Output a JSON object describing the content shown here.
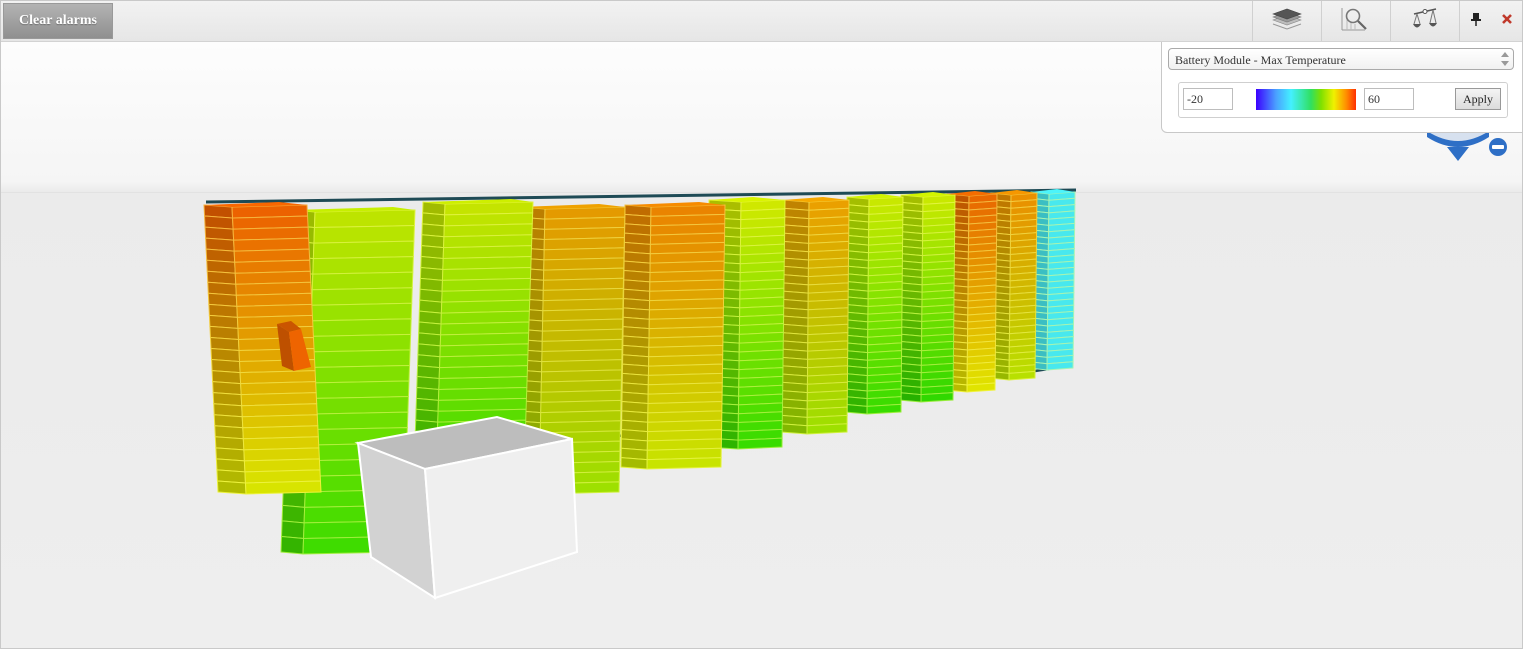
{
  "toolbar": {
    "clear_alarms_label": "Clear alarms",
    "tools": [
      {
        "name": "layers",
        "icon": "layers-icon"
      },
      {
        "name": "chart-search",
        "icon": "chart-search-icon"
      },
      {
        "name": "balance",
        "icon": "balance-scale-icon"
      }
    ],
    "pin_icon": "pin-icon",
    "close_icon": "close-icon"
  },
  "panel": {
    "metric_selected": "Battery Module - Max Temperature",
    "range_min": "-20",
    "range_max": "60",
    "apply_label": "Apply",
    "gradient_stops": [
      "#3b00ff",
      "#4aa0ff",
      "#44f0ff",
      "#30e060",
      "#7ee000",
      "#f0f000",
      "#ff9000",
      "#ff3000"
    ]
  },
  "navigation": {
    "pan_icon": "navigation-compass-icon",
    "zoom_out_icon": "zoom-out-icon",
    "zoom_in_icon": "zoom-in-icon"
  },
  "scene": {
    "racks": [
      {
        "id": "rack-1",
        "top_color": "#ec6200",
        "bottom_color": "#d8e400"
      },
      {
        "id": "rack-2",
        "top_color": "#bde400",
        "bottom_color": "#3fdc00"
      },
      {
        "id": "rack-3",
        "top_color": "#c4e400",
        "bottom_color": "#4fdc00"
      },
      {
        "id": "rack-4",
        "top_color": "#e49a00",
        "bottom_color": "#9ee000"
      },
      {
        "id": "rack-5",
        "top_color": "#ea8400",
        "bottom_color": "#c8e400"
      },
      {
        "id": "rack-6",
        "top_color": "#cfe800",
        "bottom_color": "#38dc00"
      },
      {
        "id": "rack-7",
        "top_color": "#eaa000",
        "bottom_color": "#9ee000"
      },
      {
        "id": "rack-8",
        "top_color": "#c8e800",
        "bottom_color": "#38dc00"
      },
      {
        "id": "rack-9",
        "top_color": "#c8e800",
        "bottom_color": "#30d800"
      },
      {
        "id": "rack-10",
        "top_color": "#e86800",
        "bottom_color": "#e0e400"
      },
      {
        "id": "rack-11",
        "top_color": "#ea9000",
        "bottom_color": "#b8e000"
      },
      {
        "id": "rack-12",
        "top_color": "#48e8ee",
        "bottom_color": "#48e8ee"
      }
    ],
    "alarm_module_color": "#ee6400",
    "cabinet_color": "#efefef"
  }
}
